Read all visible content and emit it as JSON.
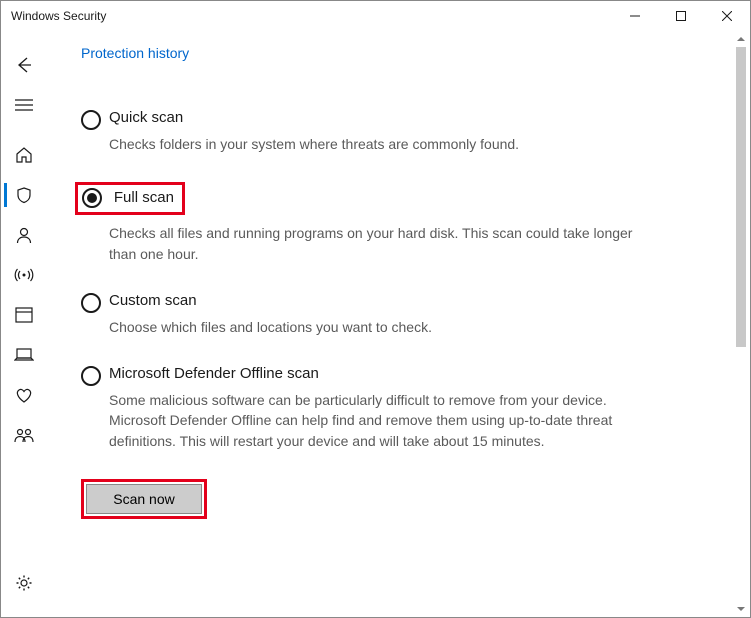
{
  "window": {
    "title": "Windows Security"
  },
  "header": {
    "protection_history_link": "Protection history"
  },
  "options": {
    "quick": {
      "title": "Quick scan",
      "desc": "Checks folders in your system where threats are commonly found."
    },
    "full": {
      "title": "Full scan",
      "desc": "Checks all files and running programs on your hard disk. This scan could take longer than one hour."
    },
    "custom": {
      "title": "Custom scan",
      "desc": "Choose which files and locations you want to check."
    },
    "offline": {
      "title": "Microsoft Defender Offline scan",
      "desc": "Some malicious software can be particularly difficult to remove from your device. Microsoft Defender Offline can help find and remove them using up-to-date threat definitions. This will restart your device and will take about 15 minutes."
    }
  },
  "actions": {
    "scan_now": "Scan now"
  },
  "sidebar_icons": {
    "back": "back-arrow",
    "menu": "hamburger",
    "home": "home",
    "shield": "shield",
    "account": "person",
    "firewall": "signal",
    "app": "window",
    "device": "laptop",
    "health": "heart",
    "family": "people",
    "settings": "gear"
  },
  "selected_option": "full",
  "colors": {
    "highlight": "#e3001b",
    "link": "#0066cc",
    "button_bg": "#cccccc",
    "accent": "#0078d4"
  }
}
